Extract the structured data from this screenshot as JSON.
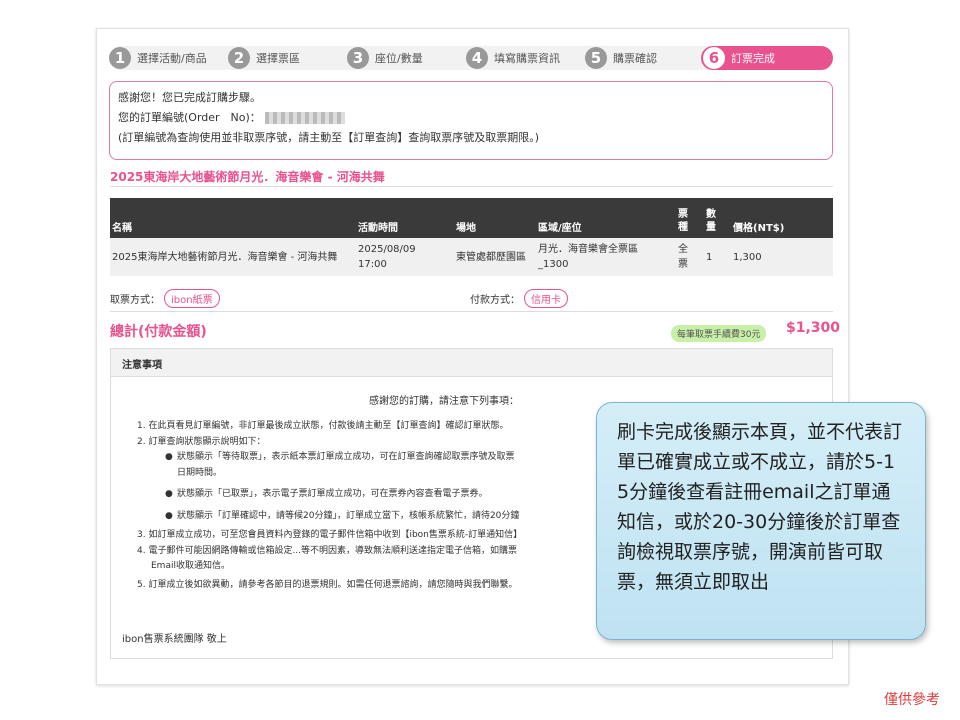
{
  "steps": [
    {
      "num": "1",
      "label": "選擇活動/商品"
    },
    {
      "num": "2",
      "label": "選擇票區"
    },
    {
      "num": "3",
      "label": "座位/數量"
    },
    {
      "num": "4",
      "label": "填寫購票資訊"
    },
    {
      "num": "5",
      "label": "購票確認"
    },
    {
      "num": "6",
      "label": "訂票完成"
    }
  ],
  "thanks": {
    "line1": "感謝您！您已完成訂購步驟。",
    "line2": "您的訂單編號(Order　No)：",
    "line3": "(訂單編號為查詢使用並非取票序號，請主動至【訂單查詢】查詢取票序號及取票期限。)"
  },
  "event_title": "2025東海岸大地藝術節月光．海音樂會 - 河海共舞",
  "table": {
    "headers": [
      "名稱",
      "活動時間",
      "場地",
      "區域/座位",
      "票種",
      "數量",
      "價格(NT$)"
    ],
    "row": [
      "2025東海岸大地藝術節月光．海音樂會 - 河海共舞",
      "2025/08/09 17:00",
      "東管處都歷園區",
      "月光．海音樂會全票區_1300",
      "全票",
      "1",
      "1,300"
    ]
  },
  "pickup": {
    "label": "取票方式：",
    "value": "ibon紙票"
  },
  "payment": {
    "label": "付款方式：",
    "value": "信用卡"
  },
  "total": {
    "label": "總計(付款金額)",
    "fee_note": "每筆取票手續費30元",
    "amount": "$1,300"
  },
  "notice": {
    "heading": "注意事項",
    "intro": "感謝您的訂購，請注意下列事項：",
    "items": [
      "1. 在此頁看見訂單編號，非訂單最後成立狀態，付款後請主動至【訂單查詢】確認訂單狀態。",
      "2. 訂單查詢狀態顯示說明如下：",
      "3. 如訂單成立成功，可至您會員資料內登錄的電子郵件信箱中收到【ibon售票系統-訂單通知信】",
      "4. 電子郵件可能因網路傳輸或信箱設定...等不明因素，導致無法順利送達指定電子信箱，如購票",
      "5. 訂單成立後如欲異動，請參考各節目的退票規則。如需任何退票諮詢，請您隨時與我們聯繫。"
    ],
    "sub_items": [
      "狀態顯示「等待取票」，表示紙本票訂單成立成功，可在訂單查詢確認取票序號及取票",
      "日期時間。",
      "狀態顯示「已取票」，表示電子票訂單成立成功，可在票券內容查看電子票券。",
      "狀態顯示「訂單確認中，請等候20分鐘」，訂單成立當下，核帳系統繁忙，請待20分鐘"
    ],
    "item4_cont": "Email收取通知信。",
    "signature": "ibon售票系統團隊 敬上"
  },
  "callout": "刷卡完成後顯示本頁，並不代表訂單已確實成立或不成立，請於5-15分鐘後查看註冊email之訂單通知信，或於20-30分鐘後於訂單查詢檢視取票序號，開演前皆可取票，無須立即取出",
  "disclaimer": "僅供參考",
  "colors": {
    "accent": "#e8528e",
    "header_bg": "#3a3a3a",
    "callout_bg": "#c8e7f4",
    "disclaimer": "#e03a3a"
  }
}
